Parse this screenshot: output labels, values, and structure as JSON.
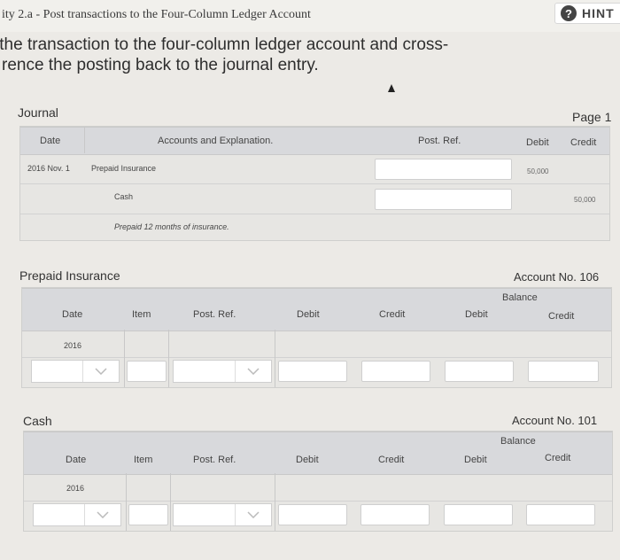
{
  "header": {
    "title": "ity 2.a - Post transactions to the Four-Column Ledger Account",
    "hint_label": "HINT",
    "instruction_line1": "the transaction to the four-column ledger account and cross-",
    "instruction_line2": "rence the posting back to the journal entry."
  },
  "journal": {
    "title": "Journal",
    "page": "Page 1",
    "headers": {
      "date": "Date",
      "accounts": "Accounts and Explanation.",
      "post_ref": "Post. Ref.",
      "debit": "Debit",
      "credit": "Credit"
    },
    "rows": [
      {
        "date": "2016 Nov. 1",
        "account": "Prepaid Insurance",
        "debit": "50,000",
        "credit": ""
      },
      {
        "date": "",
        "account": "Cash",
        "debit": "",
        "credit": "50,000"
      }
    ],
    "explanation": "Prepaid 12 months of insurance."
  },
  "ledgers": [
    {
      "title": "Prepaid Insurance",
      "account_no": "Account No. 106",
      "balance_label": "Balance",
      "headers": {
        "date": "Date",
        "item": "Item",
        "post_ref": "Post. Ref.",
        "debit": "Debit",
        "credit": "Credit",
        "balance_debit": "Debit",
        "balance_credit": "Credit"
      },
      "year": "2016"
    },
    {
      "title": "Cash",
      "account_no": "Account No. 101",
      "balance_label": "Balance",
      "headers": {
        "date": "Date",
        "item": "Item",
        "post_ref": "Post. Ref.",
        "debit": "Debit",
        "credit": "Credit",
        "balance_debit": "Debit",
        "balance_credit": "Credit"
      },
      "year": "2016"
    }
  ],
  "icons": {
    "hint": "question-circle-icon",
    "dropdown": "chevron-down-icon",
    "cursor": "mouse-cursor-icon"
  },
  "colors": {
    "page_bg": "#eceae6",
    "header_row": "#d8d9dc",
    "panel_bg": "#e7e6e3"
  }
}
